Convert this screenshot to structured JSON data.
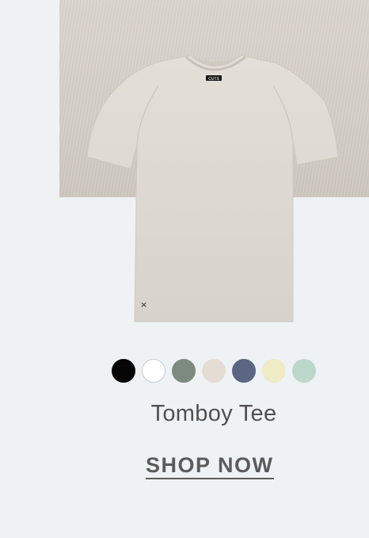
{
  "product": {
    "name": "Tomboy Tee",
    "image_alt": "Tomboy Tee",
    "label_text": "CUTS"
  },
  "swatches": [
    {
      "name": "black",
      "color": "#050505"
    },
    {
      "name": "white",
      "color": "#ffffff"
    },
    {
      "name": "sage",
      "color": "#7d8a80"
    },
    {
      "name": "sand",
      "color": "#e5ddd4"
    },
    {
      "name": "slate-blue",
      "color": "#5b6683"
    },
    {
      "name": "butter",
      "color": "#efebc7"
    },
    {
      "name": "mint",
      "color": "#bcd8cb"
    }
  ],
  "cta": {
    "label": "SHOP NOW"
  }
}
